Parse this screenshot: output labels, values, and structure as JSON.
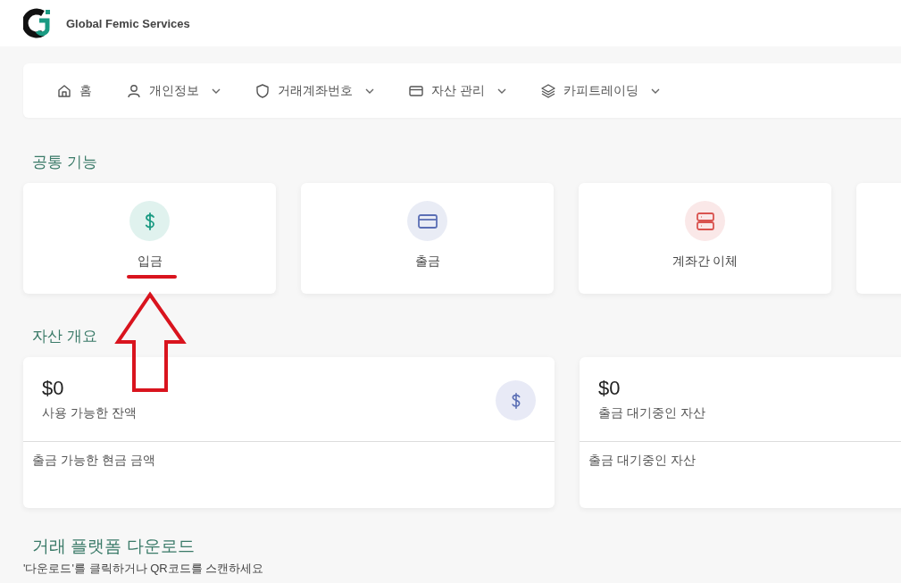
{
  "brand": {
    "name": "Global Femic Services"
  },
  "nav": [
    {
      "label": "홈",
      "kind": "home",
      "dropdown": false
    },
    {
      "label": "개인정보",
      "kind": "user",
      "dropdown": true
    },
    {
      "label": "거래계좌번호",
      "kind": "shield",
      "dropdown": true
    },
    {
      "label": "자산 관리",
      "kind": "card",
      "dropdown": true
    },
    {
      "label": "카피트레이딩",
      "kind": "layers",
      "dropdown": true
    }
  ],
  "common_functions": {
    "title": "공통 기능",
    "items": [
      {
        "label": "입금",
        "kind": "dollar",
        "color": "#1a9a82"
      },
      {
        "label": "출금",
        "kind": "card",
        "color": "#5b6fb5"
      },
      {
        "label": "계좌간 이체",
        "kind": "server",
        "color": "#d9534f"
      },
      {
        "kind": "blank"
      }
    ]
  },
  "asset_overview": {
    "title": "자산 개요",
    "cards": [
      {
        "kind": "balance",
        "amount": "$0",
        "label": "사용 가능한 잔액",
        "note": "출금 가능한 현금 금액"
      },
      {
        "kind": "pending",
        "amount": "$0",
        "label": "출금 대기중인 자산",
        "note": "출금 대기중인 자산"
      }
    ]
  },
  "download": {
    "title": "거래 플랫폼 다운로드",
    "subtitle": "'다운로드'를 클릭하거나 QR코드를 스캔하세요"
  }
}
